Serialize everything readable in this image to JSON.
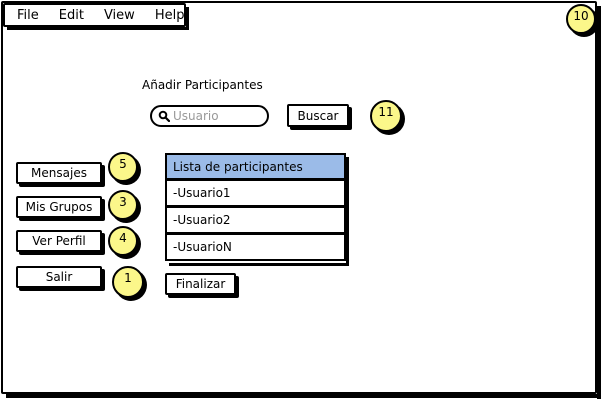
{
  "menubar": {
    "items": [
      {
        "label": "File"
      },
      {
        "label": "Edit"
      },
      {
        "label": "View"
      },
      {
        "label": "Help"
      }
    ]
  },
  "main": {
    "heading": "Añadir Participantes",
    "search": {
      "placeholder": "Usuario",
      "value": ""
    },
    "search_button": "Buscar",
    "list": {
      "header": "Lista de participantes",
      "items": [
        "-Usuario1",
        "-Usuario2",
        "-UsuarioN"
      ]
    },
    "finish_button": "Finalizar"
  },
  "sidebar": {
    "buttons": [
      {
        "label": "Mensajes"
      },
      {
        "label": "Mis Grupos"
      },
      {
        "label": "Ver Perfil"
      },
      {
        "label": "Salir"
      }
    ]
  },
  "callouts": [
    "10",
    "11",
    "5",
    "3",
    "4",
    "1"
  ],
  "colors": {
    "callout_fill": "#fbf78a",
    "list_header": "#9bbbe8",
    "placeholder": "#999999"
  },
  "icons": {
    "search": "search-icon"
  }
}
